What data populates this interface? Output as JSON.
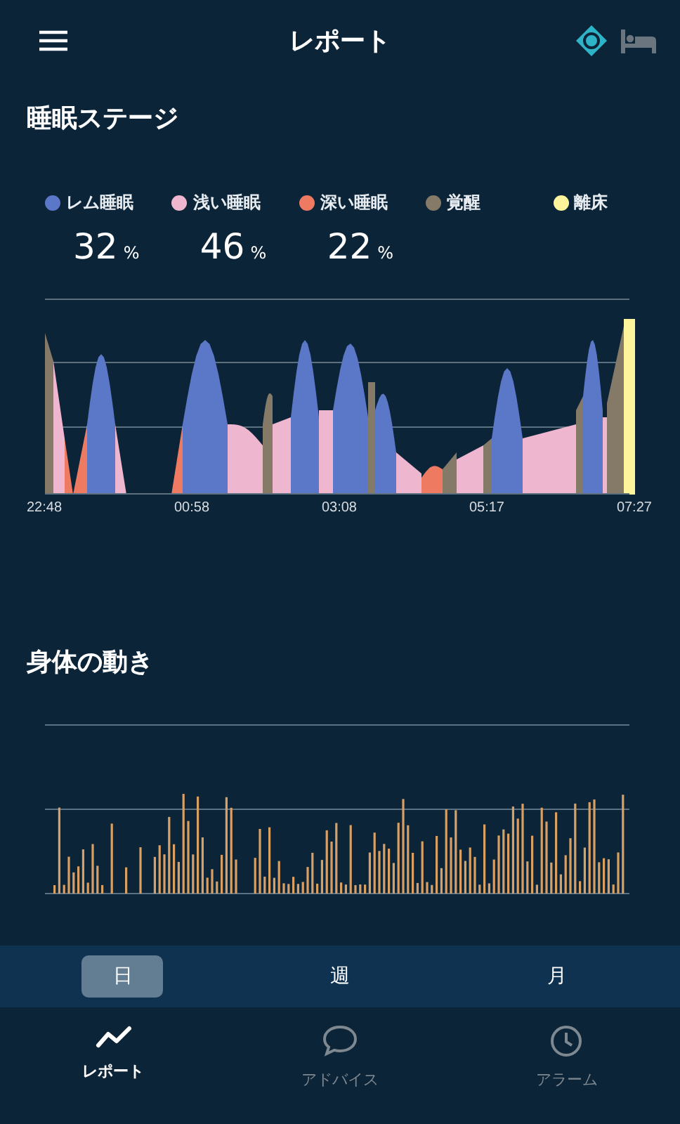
{
  "header": {
    "title": "レポート"
  },
  "sleep_stage": {
    "title": "睡眠ステージ",
    "legend": [
      {
        "label": "レム睡眠",
        "color": "#5b78c8",
        "percent": "32",
        "unit": "%"
      },
      {
        "label": "浅い睡眠",
        "color": "#eeb6cf",
        "percent": "46",
        "unit": "%"
      },
      {
        "label": "深い睡眠",
        "color": "#ee7a62",
        "percent": "22",
        "unit": "%"
      },
      {
        "label": "覚醒",
        "color": "#857a68"
      },
      {
        "label": "離床",
        "color": "#fdf49c"
      }
    ],
    "time_labels": [
      "22:48",
      "00:58",
      "03:08",
      "05:17",
      "07:27"
    ]
  },
  "movement": {
    "title": "身体の動き"
  },
  "period_tabs": [
    {
      "label": "日",
      "selected": true
    },
    {
      "label": "週",
      "selected": false
    },
    {
      "label": "月",
      "selected": false
    }
  ],
  "nav": [
    {
      "label": "レポート",
      "selected": true
    },
    {
      "label": "アドバイス",
      "selected": false
    },
    {
      "label": "アラーム",
      "selected": false
    }
  ]
}
